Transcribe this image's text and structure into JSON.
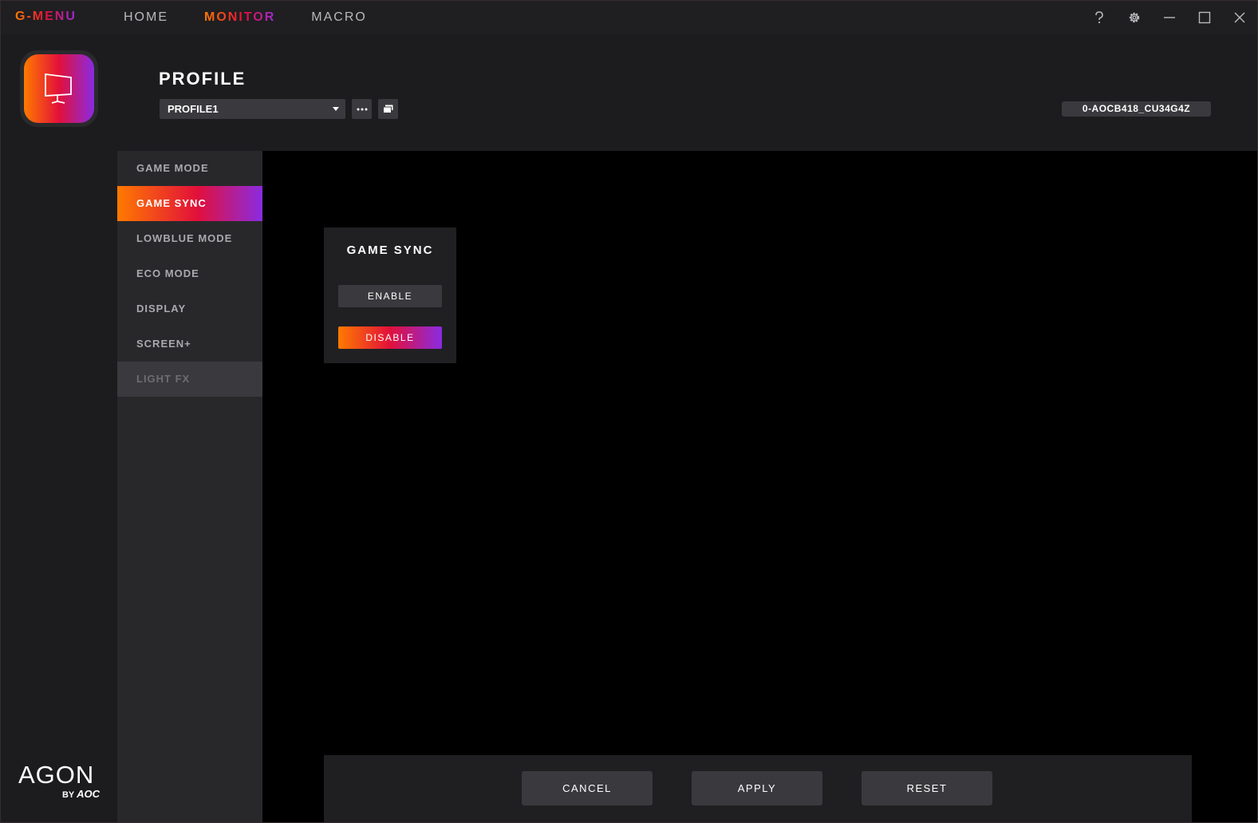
{
  "app": {
    "brand": "G-MENU",
    "nav": [
      {
        "label": "HOME"
      },
      {
        "label": "MONITOR",
        "active": true
      },
      {
        "label": "MACRO"
      }
    ],
    "controls": {
      "help_icon": "help-icon",
      "settings_icon": "gear-icon",
      "minimize_icon": "minimize-icon",
      "maximize_icon": "maximize-icon",
      "close_icon": "close-icon"
    }
  },
  "rail": {
    "logo_word": "AGON",
    "logo_by": "BY",
    "logo_brand": "AOC"
  },
  "profile": {
    "title": "PROFILE",
    "selected": "PROFILE1",
    "device_id": "0-AOCB418_CU34G4Z"
  },
  "menu": {
    "items": [
      {
        "label": "GAME MODE",
        "state": "normal"
      },
      {
        "label": "GAME SYNC",
        "state": "active"
      },
      {
        "label": "LOWBLUE MODE",
        "state": "normal"
      },
      {
        "label": "ECO MODE",
        "state": "normal"
      },
      {
        "label": "DISPLAY",
        "state": "normal"
      },
      {
        "label": "SCREEN+",
        "state": "normal"
      },
      {
        "label": "LIGHT FX",
        "state": "disabled"
      }
    ]
  },
  "panel": {
    "title": "GAME SYNC",
    "enable_label": "ENABLE",
    "disable_label": "DISABLE",
    "selected": "DISABLE"
  },
  "footer": {
    "cancel_label": "CANCEL",
    "apply_label": "APPLY",
    "reset_label": "RESET"
  },
  "colors": {
    "accent_start": "#ff7a00",
    "accent_mid": "#e2103a",
    "accent_end": "#8a2be2",
    "background": "#1c1c1e",
    "button": "#3a3a3e"
  }
}
